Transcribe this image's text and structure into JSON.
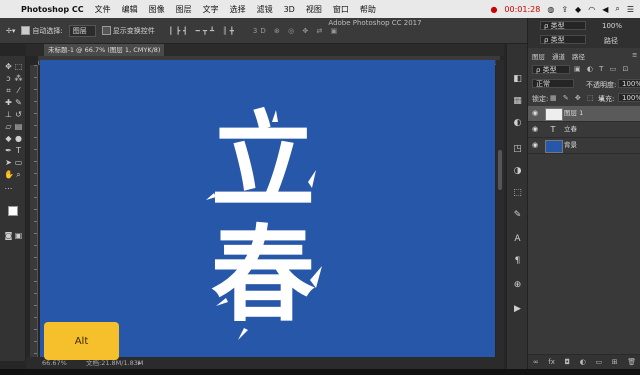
{
  "menubar": {
    "apple": "",
    "app_name": "Photoshop CC",
    "menus": [
      "文件",
      "编辑",
      "图像",
      "图层",
      "文字",
      "选择",
      "滤镜",
      "3D",
      "视图",
      "窗口",
      "帮助"
    ],
    "clock": "00:01:28"
  },
  "window_title": "Adobe Photoshop CC 2017",
  "options": {
    "auto_select_label": "自动选择:",
    "auto_select_value": "图层",
    "show_transform_label": "显示变换控件"
  },
  "document_tab": "未标题-1 @ 66.7% (图层 1, CMYK/8) *",
  "canvas": {
    "background_color": "#2657a8",
    "glyphs": [
      "立",
      "春"
    ]
  },
  "status": {
    "zoom": "66.67%",
    "doc_info": "文档:21.8M/1.83M"
  },
  "alt_key_label": "Alt",
  "right_top": {
    "search_a": "ρ 类型",
    "value": "100%",
    "search_b": "ρ 类型",
    "path_label": "路径"
  },
  "layers_panel": {
    "tabs": [
      "图层",
      "通道",
      "路径"
    ],
    "filter": "ρ 类型",
    "blend_mode": "正常",
    "opacity_label": "不透明度:",
    "opacity_value": "100%",
    "lock_label": "锁定:",
    "fill_label": "填充:",
    "fill_value": "100%",
    "layers": [
      {
        "name": "图层 1",
        "type": "pixel",
        "selected": true
      },
      {
        "name": "立春",
        "type": "text",
        "selected": false
      },
      {
        "name": "背景",
        "type": "background",
        "selected": false
      }
    ]
  },
  "colors": {
    "foreground": "#ffffff",
    "background": "#2657a8",
    "accent_key": "#f6c02c"
  }
}
